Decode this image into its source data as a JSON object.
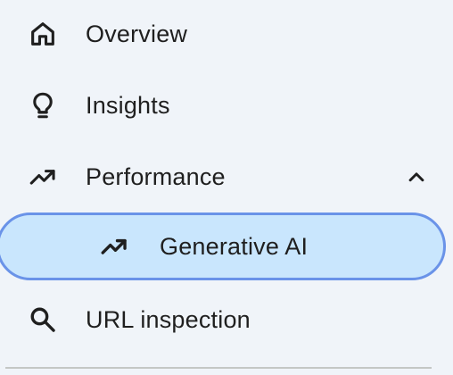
{
  "nav": {
    "items": [
      {
        "label": "Overview",
        "icon": "home-icon"
      },
      {
        "label": "Insights",
        "icon": "lightbulb-icon"
      },
      {
        "label": "Performance",
        "icon": "trending-up-icon",
        "expanded": true
      },
      {
        "label": "Generative AI",
        "icon": "trending-up-icon",
        "selected": true
      },
      {
        "label": "URL inspection",
        "icon": "search-icon"
      }
    ],
    "chevron_icon": "chevron-up-icon"
  },
  "colors": {
    "background": "#f0f4f9",
    "selected_fill": "#c9e6fd",
    "selected_border": "#6a93e8",
    "text": "#1f1f1f",
    "divider": "#c4c7c5"
  }
}
